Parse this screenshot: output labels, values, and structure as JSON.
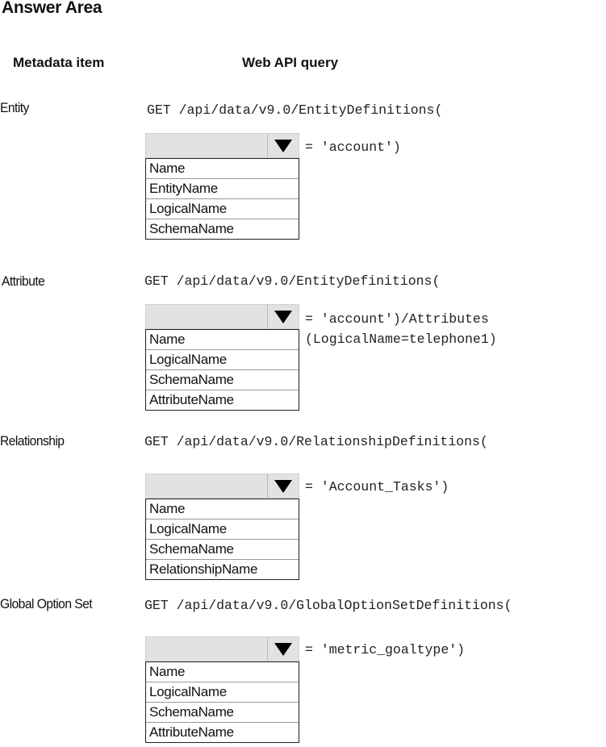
{
  "title": "Answer Area",
  "columns": {
    "metadata": "Metadata item",
    "query": "Web API query"
  },
  "rows": [
    {
      "label": "Entity",
      "query_line1": "GET /api/data/v9.0/EntityDefinitions(",
      "suffix_line1": "= 'account')",
      "suffix_line2": "",
      "dropdown": {
        "selected": "",
        "options": [
          "Name",
          "EntityName",
          "LogicalName",
          "SchemaName"
        ]
      }
    },
    {
      "label": "Attribute",
      "query_line1": "GET /api/data/v9.0/EntityDefinitions(",
      "suffix_line1": "= 'account')/Attributes",
      "suffix_line2": "(LogicalName=telephone1)",
      "dropdown": {
        "selected": "",
        "options": [
          "Name",
          "LogicalName",
          "SchemaName",
          "AttributeName"
        ]
      }
    },
    {
      "label": "Relationship",
      "query_line1": "GET /api/data/v9.0/RelationshipDefinitions(",
      "suffix_line1": "= 'Account_Tasks')",
      "suffix_line2": "",
      "dropdown": {
        "selected": "",
        "options": [
          "Name",
          "LogicalName",
          "SchemaName",
          "RelationshipName"
        ]
      }
    },
    {
      "label": "Global Option Set",
      "query_line1": "GET /api/data/v9.0/GlobalOptionSetDefinitions(",
      "suffix_line1": "= 'metric_goaltype')",
      "suffix_line2": "",
      "dropdown": {
        "selected": "",
        "options": [
          "Name",
          "LogicalName",
          "SchemaName",
          "AttributeName"
        ]
      }
    }
  ]
}
